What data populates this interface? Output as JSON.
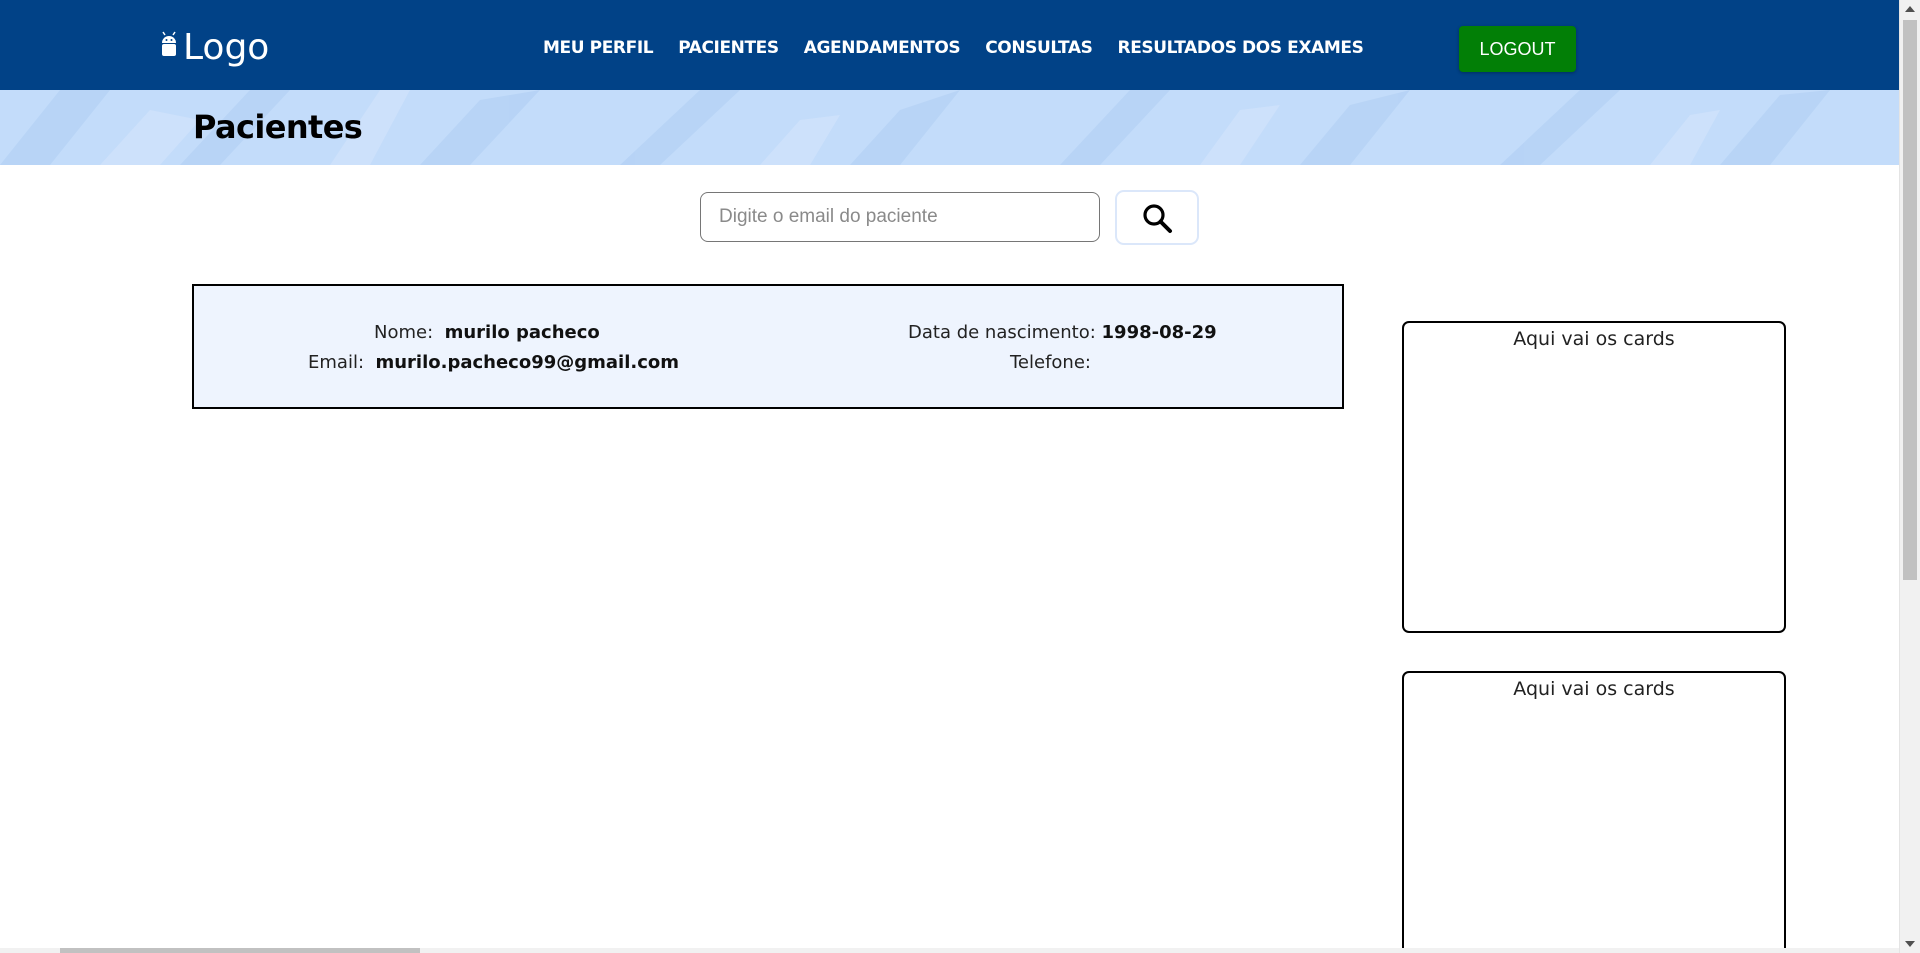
{
  "navbar": {
    "logo_text": "Logo",
    "logo_icon": "android-icon",
    "links": [
      "MEU PERFIL",
      "PACIENTES",
      "AGENDAMENTOS",
      "CONSULTAS",
      "RESULTADOS DOS EXAMES"
    ],
    "logout_label": "LOGOUT",
    "background_color": "#014287",
    "logout_color": "#027f06"
  },
  "banner": {
    "title": "Pacientes",
    "background_color": "#c3dcfa"
  },
  "search": {
    "placeholder": "Digite o email do paciente",
    "value": "",
    "button_icon": "search-icon"
  },
  "patient": {
    "name_label": "Nome:",
    "name": "murilo pacheco",
    "email_label": "Email:",
    "email": "murilo.pacheco99@gmail.com",
    "birth_label": "Data de nascimento:",
    "birth_date": "1998-08-29",
    "phone_label": "Telefone:",
    "phone": ""
  },
  "side_cards": [
    {
      "text": "Aqui vai os cards"
    },
    {
      "text": "Aqui vai os cards"
    }
  ]
}
